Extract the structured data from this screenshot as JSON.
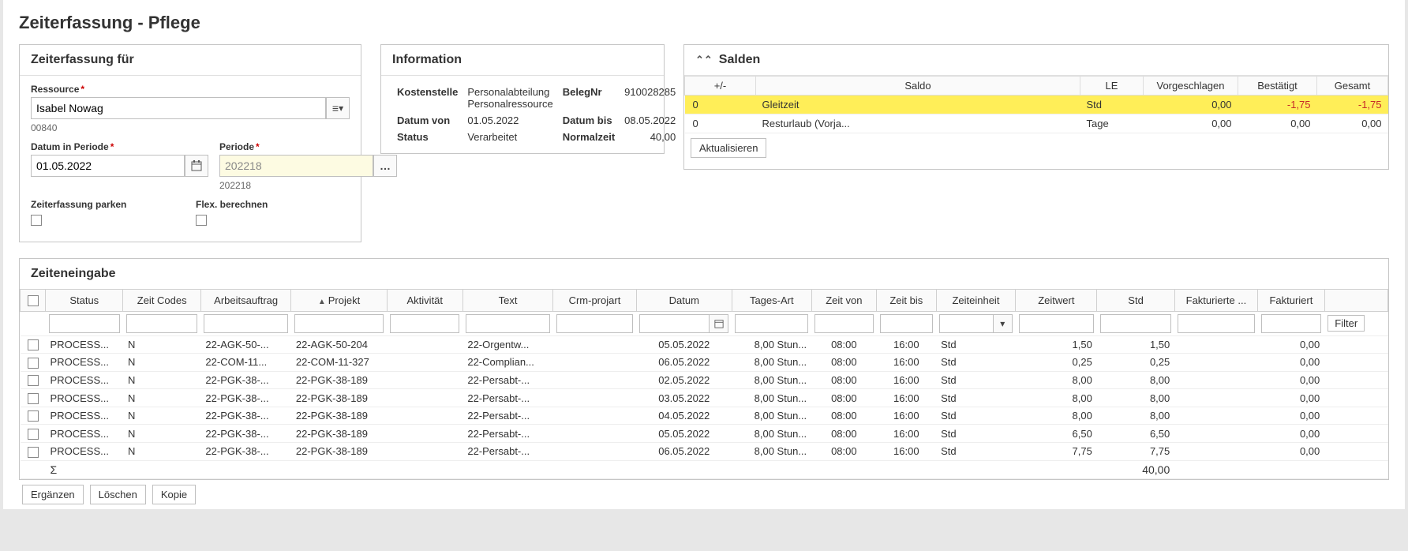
{
  "title": "Zeiterfassung - Pflege",
  "panel_for": {
    "heading": "Zeiterfassung für",
    "ressource_label": "Ressource",
    "ressource_value": "Isabel Nowag",
    "ressource_code": "00840",
    "datum_label": "Datum in Periode",
    "datum_value": "01.05.2022",
    "periode_label": "Periode",
    "periode_value": "202218",
    "periode_sub": "202218",
    "parken_label": "Zeiterfassung parken",
    "flex_label": "Flex. berechnen"
  },
  "panel_info": {
    "heading": "Information",
    "kostenstelle_label": "Kostenstelle",
    "kostenstelle_value_1": "Personalabteilung",
    "kostenstelle_value_2": "Personalressource",
    "belegnr_label": "BelegNr",
    "belegnr_value": "910028285",
    "datumvon_label": "Datum von",
    "datumvon_value": "01.05.2022",
    "datumbis_label": "Datum bis",
    "datumbis_value": "08.05.2022",
    "status_label": "Status",
    "status_value": "Verarbeitet",
    "normalzeit_label": "Normalzeit",
    "normalzeit_value": "40,00"
  },
  "panel_salden": {
    "heading": "Salden",
    "col_pm": "+/-",
    "col_saldo": "Saldo",
    "col_le": "LE",
    "col_vorg": "Vorgeschlagen",
    "col_best": "Bestätigt",
    "col_ges": "Gesamt",
    "rows": [
      {
        "pm": "0",
        "saldo": "Gleitzeit",
        "le": "Std",
        "vorg": "0,00",
        "best": "-1,75",
        "ges": "-1,75",
        "neg": true,
        "hl": true
      },
      {
        "pm": "0",
        "saldo": "Resturlaub (Vorja...",
        "le": "Tage",
        "vorg": "0,00",
        "best": "0,00",
        "ges": "0,00"
      }
    ],
    "refresh": "Aktualisieren"
  },
  "panel_ze": {
    "heading": "Zeiteneingabe",
    "cols": [
      "Status",
      "Zeit Codes",
      "Arbeitsauftrag",
      "Projekt",
      "Aktivität",
      "Text",
      "Crm-projart",
      "Datum",
      "Tages-Art",
      "Zeit von",
      "Zeit bis",
      "Zeiteinheit",
      "Zeitwert",
      "Std",
      "Fakturierte ...",
      "Fakturiert"
    ],
    "filter_btn": "Filter",
    "rows": [
      {
        "status": "PROCESS...",
        "zc": "N",
        "aa": "22-AGK-50-...",
        "proj": "22-AGK-50-204",
        "akt": "",
        "txt": "22-Orgentw...",
        "crm": "",
        "datum": "05.05.2022",
        "tag": "8,00 Stun...",
        "von": "08:00",
        "bis": "16:00",
        "ze": "Std",
        "zw": "1,50",
        "std": "1,50",
        "fs": "",
        "fak": "0,00"
      },
      {
        "status": "PROCESS...",
        "zc": "N",
        "aa": "22-COM-11...",
        "proj": "22-COM-11-327",
        "akt": "",
        "txt": "22-Complian...",
        "crm": "",
        "datum": "06.05.2022",
        "tag": "8,00 Stun...",
        "von": "08:00",
        "bis": "16:00",
        "ze": "Std",
        "zw": "0,25",
        "std": "0,25",
        "fs": "",
        "fak": "0,00"
      },
      {
        "status": "PROCESS...",
        "zc": "N",
        "aa": "22-PGK-38-...",
        "proj": "22-PGK-38-189",
        "akt": "",
        "txt": "22-Persabt-...",
        "crm": "",
        "datum": "02.05.2022",
        "tag": "8,00 Stun...",
        "von": "08:00",
        "bis": "16:00",
        "ze": "Std",
        "zw": "8,00",
        "std": "8,00",
        "fs": "",
        "fak": "0,00"
      },
      {
        "status": "PROCESS...",
        "zc": "N",
        "aa": "22-PGK-38-...",
        "proj": "22-PGK-38-189",
        "akt": "",
        "txt": "22-Persabt-...",
        "crm": "",
        "datum": "03.05.2022",
        "tag": "8,00 Stun...",
        "von": "08:00",
        "bis": "16:00",
        "ze": "Std",
        "zw": "8,00",
        "std": "8,00",
        "fs": "",
        "fak": "0,00"
      },
      {
        "status": "PROCESS...",
        "zc": "N",
        "aa": "22-PGK-38-...",
        "proj": "22-PGK-38-189",
        "akt": "",
        "txt": "22-Persabt-...",
        "crm": "",
        "datum": "04.05.2022",
        "tag": "8,00 Stun...",
        "von": "08:00",
        "bis": "16:00",
        "ze": "Std",
        "zw": "8,00",
        "std": "8,00",
        "fs": "",
        "fak": "0,00"
      },
      {
        "status": "PROCESS...",
        "zc": "N",
        "aa": "22-PGK-38-...",
        "proj": "22-PGK-38-189",
        "akt": "",
        "txt": "22-Persabt-...",
        "crm": "",
        "datum": "05.05.2022",
        "tag": "8,00 Stun...",
        "von": "08:00",
        "bis": "16:00",
        "ze": "Std",
        "zw": "6,50",
        "std": "6,50",
        "fs": "",
        "fak": "0,00"
      },
      {
        "status": "PROCESS...",
        "zc": "N",
        "aa": "22-PGK-38-...",
        "proj": "22-PGK-38-189",
        "akt": "",
        "txt": "22-Persabt-...",
        "crm": "",
        "datum": "06.05.2022",
        "tag": "8,00 Stun...",
        "von": "08:00",
        "bis": "16:00",
        "ze": "Std",
        "zw": "7,75",
        "std": "7,75",
        "fs": "",
        "fak": "0,00"
      }
    ],
    "sum_label": "Σ",
    "sum_std": "40,00",
    "btn_erg": "Ergänzen",
    "btn_del": "Löschen",
    "btn_copy": "Kopie"
  }
}
